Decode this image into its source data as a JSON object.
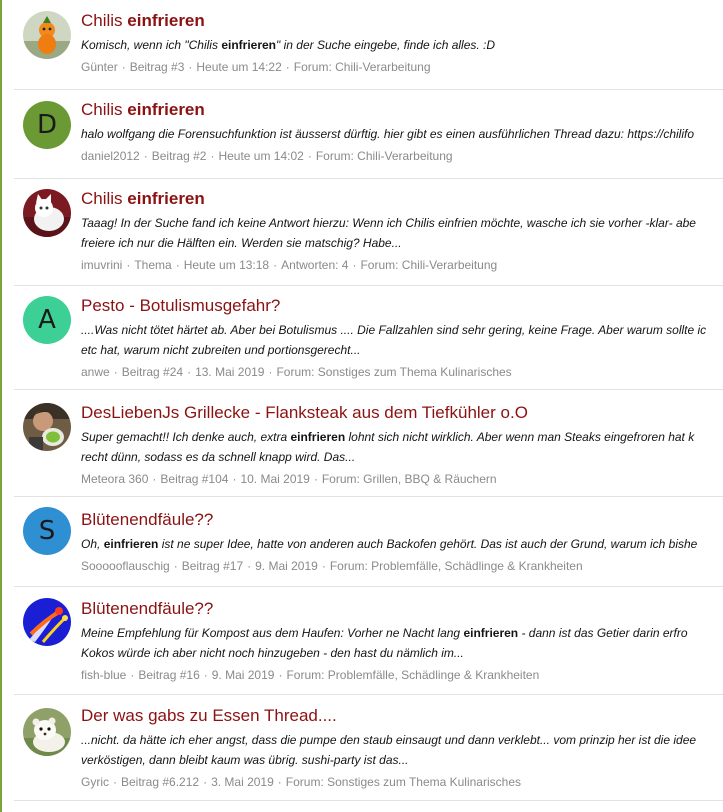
{
  "colors": {
    "accent_bar": "#7aa33c",
    "title": "#8b1212",
    "meta": "#8a8a8a"
  },
  "results": [
    {
      "title_pre": "Chilis ",
      "title_bold": "einfrieren",
      "title_post": "",
      "avatar": {
        "type": "image",
        "icon": "orange-chili-doll-avatar"
      },
      "snippet_lines": [
        [
          {
            "t": "Komisch, wenn ich \"Chilis "
          },
          {
            "t": "einfrieren",
            "b": true
          },
          {
            "t": "\" in der Suche eingebe, finde ich alles. :D"
          }
        ]
      ],
      "meta": [
        "Günter",
        "Beitrag #3",
        "Heute um 14:22",
        "Forum: Chili-Verarbeitung"
      ]
    },
    {
      "title_pre": "Chilis ",
      "title_bold": "einfrieren",
      "title_post": "",
      "avatar": {
        "type": "letter",
        "letter": "D",
        "color": "#6b9a35"
      },
      "snippet_lines": [
        [
          {
            "t": "halo wolfgang die Forensuchfunktion ist äusserst dürftig. hier gibt es einen ausführlichen Thread dazu: https://chilifo"
          }
        ]
      ],
      "meta": [
        "daniel2012",
        "Beitrag #2",
        "Heute um 14:02",
        "Forum: Chili-Verarbeitung"
      ]
    },
    {
      "title_pre": "Chilis ",
      "title_bold": "einfrieren",
      "title_post": "",
      "avatar": {
        "type": "image",
        "icon": "white-cat-avatar"
      },
      "snippet_lines": [
        [
          {
            "t": "Taaag! In der Suche fand ich keine Antwort hierzu: Wenn ich Chilis einfrien möchte, wasche ich sie vorher -klar- abe"
          }
        ],
        [
          {
            "t": "freiere ich nur die Hälften ein. Werden sie matschig? Habe..."
          }
        ]
      ],
      "meta": [
        "imuvrini",
        "Thema",
        "Heute um 13:18",
        "Antworten: 4",
        "Forum: Chili-Verarbeitung"
      ]
    },
    {
      "title_pre": "Pesto - Botulismusgefahr?",
      "title_bold": "",
      "title_post": "",
      "avatar": {
        "type": "letter",
        "letter": "A",
        "color": "#3ccf96"
      },
      "snippet_lines": [
        [
          {
            "t": "....Was nicht tötet härtet ab. Aber bei Botulismus .... Die Fallzahlen sind sehr gering, keine Frage. Aber warum sollte ic"
          }
        ],
        [
          {
            "t": "etc hat, warum nicht zubreiten und portionsgerecht..."
          }
        ]
      ],
      "meta": [
        "anwe",
        "Beitrag #24",
        "13. Mai 2019",
        "Forum: Sonstiges zum Thema Kulinarisches"
      ]
    },
    {
      "title_pre": "DesLiebenJs Grillecke - Flanksteak aus dem Tiefkühler o.O",
      "title_bold": "",
      "title_post": "",
      "avatar": {
        "type": "image",
        "icon": "person-with-melon-avatar"
      },
      "snippet_lines": [
        [
          {
            "t": "Super gemacht!! Ich denke auch, extra "
          },
          {
            "t": "einfrieren",
            "b": true
          },
          {
            "t": " lohnt sich nicht wirklich. Aber wenn man Steaks eingefroren hat k"
          }
        ],
        [
          {
            "t": "recht dünn, sodass es da schnell knapp wird. Das..."
          }
        ]
      ],
      "meta": [
        "Meteora 360",
        "Beitrag #104",
        "10. Mai 2019",
        "Forum: Grillen, BBQ & Räuchern"
      ]
    },
    {
      "title_pre": "Blütenendfäule??",
      "title_bold": "",
      "title_post": "",
      "avatar": {
        "type": "letter",
        "letter": "S",
        "color": "#2f8fd3"
      },
      "snippet_lines": [
        [
          {
            "t": "Oh, "
          },
          {
            "t": "einfrieren",
            "b": true
          },
          {
            "t": " ist ne super Idee, hatte von anderen auch Backofen gehört. Das ist auch der Grund, warum ich bishe"
          }
        ]
      ],
      "meta": [
        "Soooooflauschig",
        "Beitrag #17",
        "9. Mai 2019",
        "Forum: Problemfälle, Schädlinge & Krankheiten"
      ]
    },
    {
      "title_pre": "Blütenendfäule??",
      "title_bold": "",
      "title_post": "",
      "avatar": {
        "type": "image",
        "icon": "blue-comet-avatar"
      },
      "snippet_lines": [
        [
          {
            "t": "Meine Empfehlung für Kompost aus dem Haufen: Vorher ne Nacht lang "
          },
          {
            "t": "einfrieren",
            "b": true
          },
          {
            "t": " - dann ist das Getier darin erfro"
          }
        ],
        [
          {
            "t": "Kokos würde ich aber nicht noch hinzugeben - den hast du nämlich im..."
          }
        ]
      ],
      "meta": [
        "fish-blue",
        "Beitrag #16",
        "9. Mai 2019",
        "Forum: Problemfälle, Schädlinge & Krankheiten"
      ]
    },
    {
      "title_pre": "Der was gabs zu Essen Thread....",
      "title_bold": "",
      "title_post": "",
      "avatar": {
        "type": "image",
        "icon": "white-ferret-avatar"
      },
      "snippet_lines": [
        [
          {
            "t": "...nicht. da hätte ich eher angst, dass die pumpe den staub einsaugt und dann verklebt... vom prinzip her ist die idee"
          }
        ],
        [
          {
            "t": "verköstigen, dann bleibt kaum was übrig. sushi-party ist das..."
          }
        ]
      ],
      "meta": [
        "Gyric",
        "Beitrag #6.212",
        "3. Mai 2019",
        "Forum: Sonstiges zum Thema Kulinarisches"
      ]
    }
  ]
}
